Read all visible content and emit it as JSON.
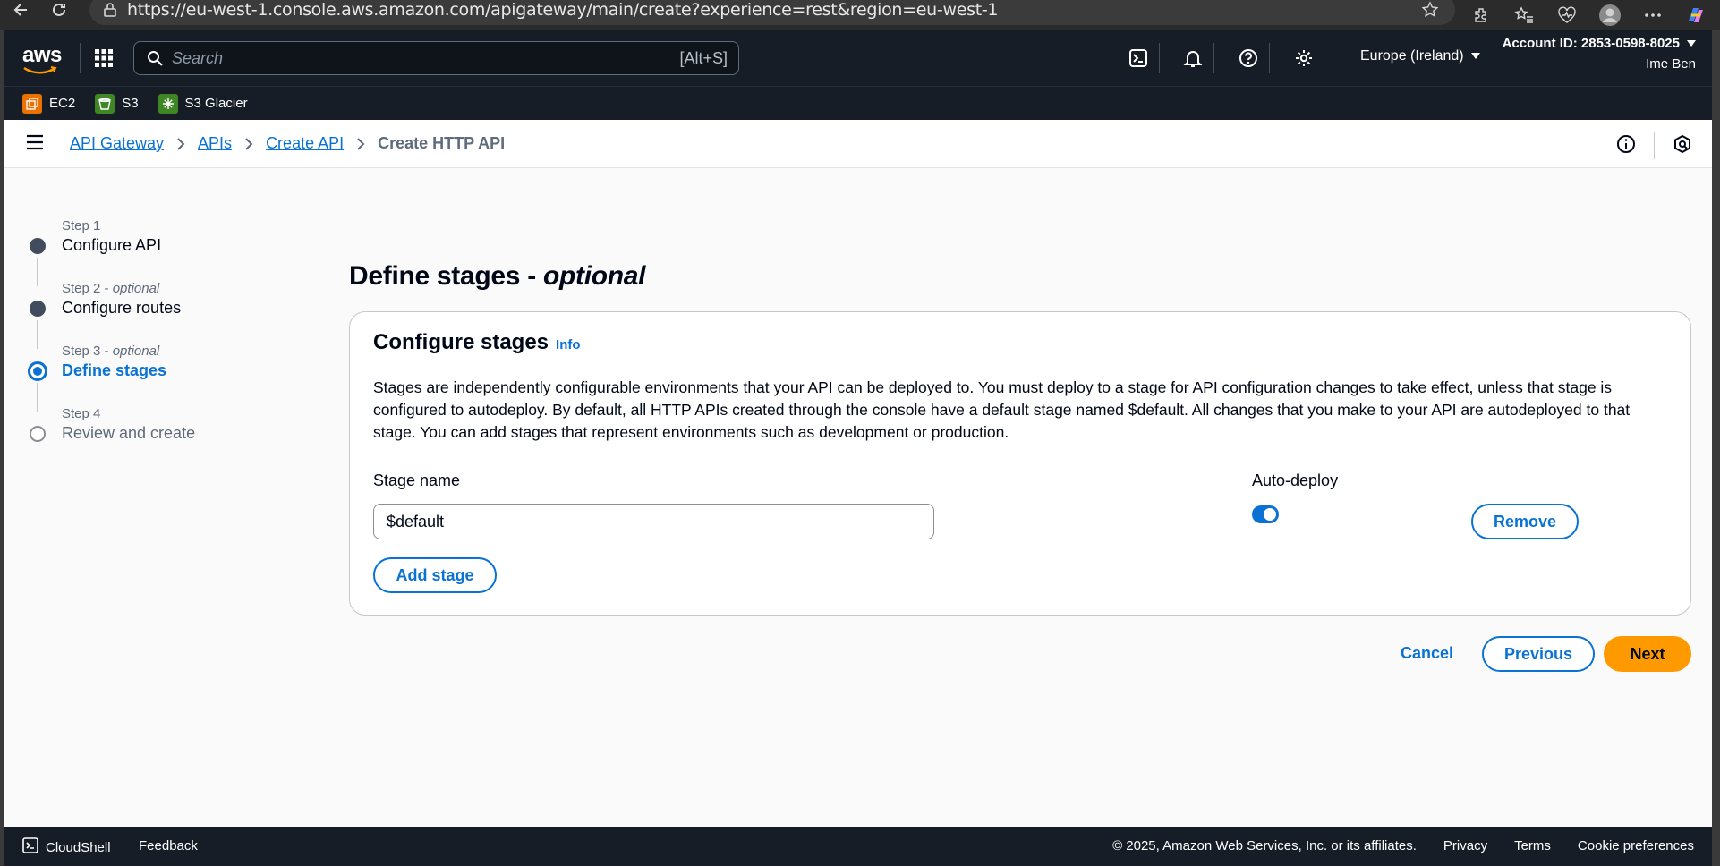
{
  "browser": {
    "url": "https://eu-west-1.console.aws.amazon.com/apigateway/main/create?experience=rest&region=eu-west-1"
  },
  "header": {
    "logo": "aws",
    "search_placeholder": "Search",
    "search_shortcut": "[Alt+S]",
    "region": "Europe (Ireland)",
    "account_id": "Account ID: 2853-0598-8025",
    "user": "Ime Ben"
  },
  "favorites": [
    {
      "label": "EC2",
      "color": "#ed7100"
    },
    {
      "label": "S3",
      "color": "#3f8624"
    },
    {
      "label": "S3 Glacier",
      "color": "#3f8624"
    }
  ],
  "breadcrumb": {
    "items": [
      "API Gateway",
      "APIs",
      "Create API"
    ],
    "current": "Create HTTP API"
  },
  "steps": [
    {
      "label": "Step 1",
      "optional": "",
      "name": "Configure API",
      "state": "done"
    },
    {
      "label": "Step 2",
      "optional": "optional",
      "name": "Configure routes",
      "state": "done"
    },
    {
      "label": "Step 3",
      "optional": "optional",
      "name": "Define stages",
      "state": "current"
    },
    {
      "label": "Step 4",
      "optional": "",
      "name": "Review and create",
      "state": "todo"
    }
  ],
  "page": {
    "title": "Define stages -",
    "title_suffix": "optional"
  },
  "card": {
    "title": "Configure stages",
    "info": "Info",
    "description": "Stages are independently configurable environments that your API can be deployed to. You must deploy to a stage for API configuration changes to take effect, unless that stage is configured to autodeploy. By default, all HTTP APIs created through the console have a default stage named $default. All changes that you make to your API are autodeployed to that stage. You can add stages that represent environments such as development or production.",
    "stage_name_label": "Stage name",
    "stage_name_value": "$default",
    "auto_deploy_label": "Auto-deploy",
    "auto_deploy_on": true,
    "remove_label": "Remove",
    "add_stage_label": "Add stage"
  },
  "actions": {
    "cancel": "Cancel",
    "previous": "Previous",
    "next": "Next"
  },
  "footer": {
    "cloudshell": "CloudShell",
    "feedback": "Feedback",
    "copyright": "© 2025, Amazon Web Services, Inc. or its affiliates.",
    "links": [
      "Privacy",
      "Terms",
      "Cookie preferences"
    ]
  },
  "colors": {
    "accent": "#0972d3",
    "primary_button": "#ff9900",
    "header_bg": "#161d26"
  }
}
